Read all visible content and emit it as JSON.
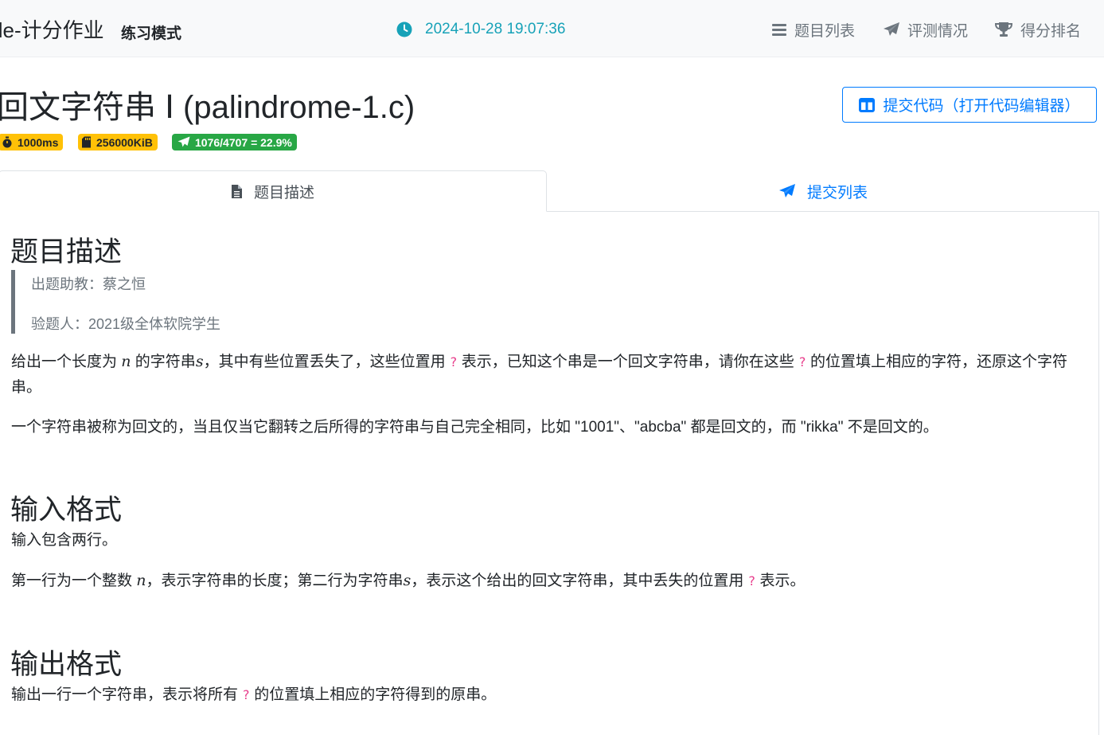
{
  "navbar": {
    "brand": "ile-计分作业",
    "mode": "练习模式",
    "datetime": "2024-10-28 19:07:36",
    "items": [
      {
        "label": "题目列表",
        "icon": "list-icon"
      },
      {
        "label": "评测情况",
        "icon": "paper-plane-icon"
      },
      {
        "label": "得分排名",
        "icon": "trophy-icon"
      }
    ]
  },
  "problem": {
    "title": "回文字符串 Ⅰ (palindrome-1.c)",
    "submit_label": "提交代码（打开代码编辑器）",
    "badges": {
      "time": "1000ms",
      "memory": "256000KiB",
      "ratio": "1076/4707 = 22.9%"
    }
  },
  "tabs": {
    "description": "题目描述",
    "submissions": "提交列表"
  },
  "content": {
    "desc_heading": "题目描述",
    "author_line": "出题助教：蔡之恒",
    "tester_line": "验题人：2021级全体软院学生",
    "p1_a": "给出一个长度为 ",
    "p1_var_n": "n",
    "p1_b": " 的字符串",
    "p1_var_s": "s",
    "p1_c": "，其中有些位置丢失了，这些位置用 ",
    "p1_q1": "?",
    "p1_d": " 表示，已知这个串是一个回文字符串，请你在这些 ",
    "p1_q2": "?",
    "p1_e": " 的位置填上相应的字符，还原这个字符串。",
    "p2": "一个字符串被称为回文的，当且仅当它翻转之后所得的字符串与自己完全相同，比如 \"1001\"、\"abcba\" 都是回文的，而 \"rikka\" 不是回文的。",
    "input_heading": "输入格式",
    "input_p1": "输入包含两行。",
    "input_p2_a": "第一行为一个整数 ",
    "input_p2_var_n": "n",
    "input_p2_b": "，表示字符串的长度；第二行为字符串",
    "input_p2_var_s": "s",
    "input_p2_c": "，表示这个给出的回文字符串，其中丢失的位置用 ",
    "input_p2_q": "?",
    "input_p2_d": " 表示。",
    "output_heading": "输出格式",
    "output_p_a": "输出一行一个字符串，表示将所有 ",
    "output_p_q": "?",
    "output_p_b": " 的位置填上相应的字符得到的原串。"
  },
  "colors": {
    "primary": "#007bff",
    "info": "#17a2b8",
    "warning": "#ffc107",
    "success": "#28a745",
    "code": "#e83e8c"
  }
}
